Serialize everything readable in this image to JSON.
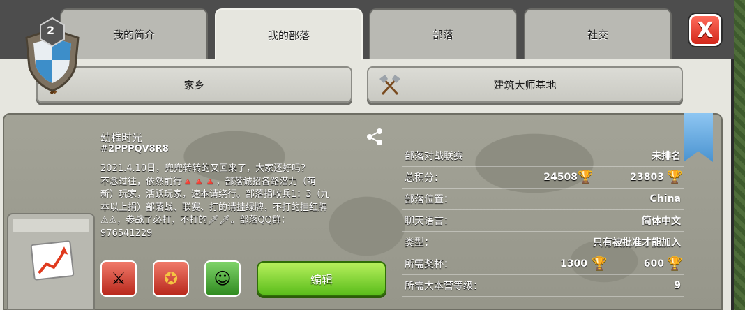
{
  "tabs": [
    {
      "label": "我的简介"
    },
    {
      "label": "我的部落"
    },
    {
      "label": "部落"
    },
    {
      "label": "社交"
    }
  ],
  "close": {
    "label": "X"
  },
  "subtabs": [
    {
      "label": "家乡",
      "icon": "sword-icon"
    },
    {
      "label": "建筑大师基地",
      "icon": "crossed-axes-icon"
    }
  ],
  "clan": {
    "level": "2",
    "name": "幼稚时光",
    "tag": "#2PPPQV8R8",
    "description": "2021.4.10日，兜兜转转的又回来了，大家还好吗？\n不念过往，依然前行🔺🔺🔺，部落诚招各路潜力（萌\n新）玩家，活跃玩家，速本请绕行。部落捐收兵1：3（九\n本以上捐）部落战、联赛、打的请挂绿牌，不打的挂红牌\n⚠⚠，参战了必打，不打的🗡🗡。部落QQ群：\n976541229",
    "edit_label": "编辑"
  },
  "info": {
    "war_league": {
      "label": "部落对战联赛",
      "value": "未排名"
    },
    "total_points": {
      "label": "总积分：",
      "value1": "24508",
      "value2": "23803"
    },
    "location": {
      "label": "部落位置：",
      "value": "China"
    },
    "chat_language": {
      "label": "聊天语言：",
      "value": "简体中文"
    },
    "type": {
      "label": "类型：",
      "value": "只有被批准才能加入"
    },
    "required_trophies": {
      "label": "所需奖杯：",
      "value1": "1300",
      "value2": "600"
    },
    "required_townhall": {
      "label": "所需大本营等级：",
      "value": "9"
    }
  },
  "colors": {
    "edit_button": "#5bbd1b",
    "close_button": "#d2271a",
    "ribbon": "#4a93d0"
  }
}
